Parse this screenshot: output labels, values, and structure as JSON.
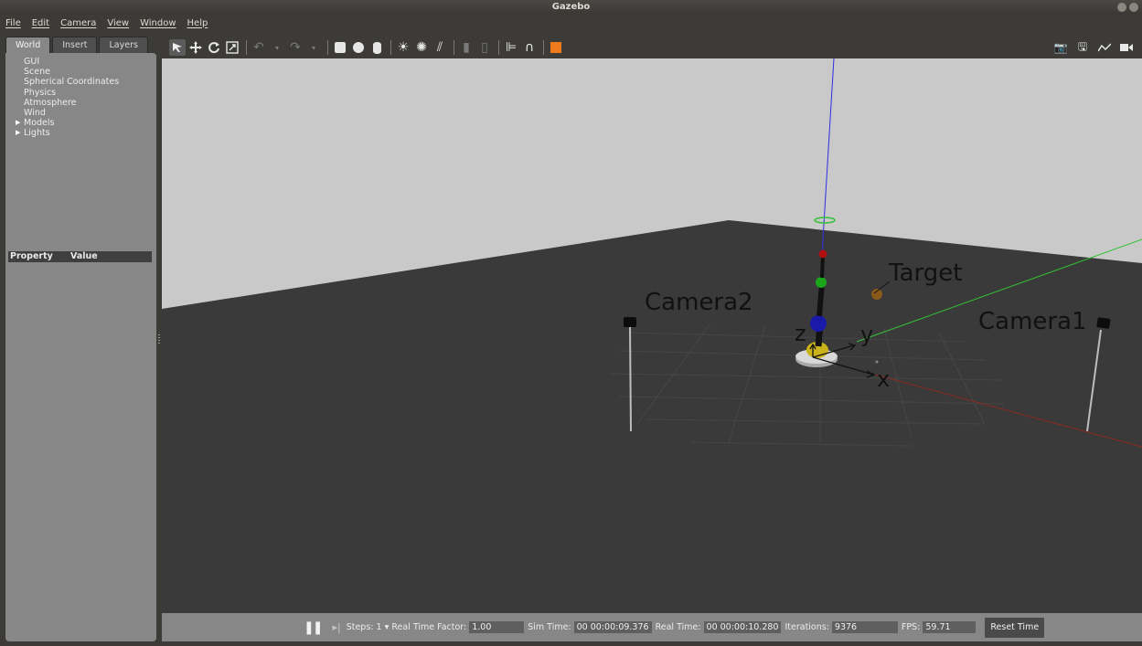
{
  "window": {
    "title": "Gazebo"
  },
  "menu": [
    "File",
    "Edit",
    "Camera",
    "View",
    "Window",
    "Help"
  ],
  "left_panel": {
    "tabs": [
      "World",
      "Insert",
      "Layers"
    ],
    "active_tab": "World",
    "tree": [
      {
        "label": "GUI",
        "expandable": false
      },
      {
        "label": "Scene",
        "expandable": false
      },
      {
        "label": "Spherical Coordinates",
        "expandable": false
      },
      {
        "label": "Physics",
        "expandable": false
      },
      {
        "label": "Atmosphere",
        "expandable": false
      },
      {
        "label": "Wind",
        "expandable": false
      },
      {
        "label": "Models",
        "expandable": true
      },
      {
        "label": "Lights",
        "expandable": true
      }
    ],
    "property_header": {
      "property": "Property",
      "value": "Value"
    }
  },
  "toolbar": {
    "icons": [
      "select-icon",
      "translate-icon",
      "rotate-icon",
      "scale-icon",
      "undo-icon",
      "redo-icon",
      "box-icon",
      "sphere-icon",
      "cylinder-icon",
      "point-light-icon",
      "spot-light-icon",
      "directional-light-icon",
      "copy-icon",
      "paste-icon",
      "align-icon",
      "snap-icon",
      "view-angle-icon"
    ],
    "right_icons": [
      "screenshot-icon",
      "log-icon",
      "plot-icon",
      "record-icon"
    ]
  },
  "scene": {
    "labels": {
      "camera2": "Camera2",
      "camera1": "Camera1",
      "target": "Target",
      "axis_x": "x",
      "axis_y": "y",
      "axis_z": "z"
    },
    "colors": {
      "wall": "#c9c9c9",
      "floor": "#3a3a3a",
      "x_axis": "#c0392b",
      "y_axis": "#35c035",
      "z_axis": "#2f2fe6"
    }
  },
  "bottom": {
    "steps_label": "Steps:",
    "steps_value": "1",
    "rtf_label": "Real Time Factor:",
    "rtf_value": "1.00",
    "sim_time_label": "Sim Time:",
    "sim_time_value": "00 00:00:09.376",
    "real_time_label": "Real Time:",
    "real_time_value": "00 00:00:10.280",
    "iterations_label": "Iterations:",
    "iterations_value": "9376",
    "fps_label": "FPS:",
    "fps_value": "59.71",
    "reset_label": "Reset Time"
  }
}
